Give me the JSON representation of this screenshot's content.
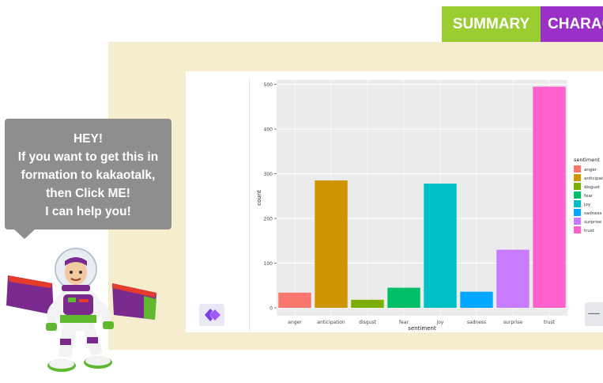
{
  "nav": {
    "summary_label": "SUMMARY",
    "character_label": "CHARAC"
  },
  "speech_bubble": {
    "lines": [
      "HEY!",
      "If you want to get this in",
      "formation to kakaotalk,",
      "then Click ME!",
      "I can help you!"
    ]
  },
  "colors": {
    "summary_tab": "#9acd32",
    "character_tab": "#9b30c8",
    "panel_bg": "#f6ecce",
    "bubble_bg": "#8e8e8e",
    "plot_bg": "#ebebeb"
  },
  "icons": {
    "diamond_button": "diamond-logo-icon",
    "minus_button": "minus-icon"
  },
  "minus_label": "—",
  "chart_data": {
    "type": "bar",
    "xlabel": "sentiment",
    "ylabel": "count",
    "ylim": [
      0,
      510
    ],
    "yticks": [
      0,
      100,
      200,
      300,
      400,
      500
    ],
    "categories": [
      "anger",
      "anticipation",
      "disgust",
      "fear",
      "joy",
      "sadness",
      "surprise",
      "trust"
    ],
    "values": [
      34,
      285,
      18,
      45,
      278,
      36,
      130,
      495
    ],
    "colors": [
      "#f8766d",
      "#cd9600",
      "#7cae00",
      "#00be67",
      "#00bfc4",
      "#00a9ff",
      "#c77cff",
      "#ff61cc"
    ],
    "grid": true,
    "legend": {
      "title": "sentiment",
      "position": "right",
      "labels": [
        "anger",
        "anticipat",
        "disgust",
        "fear",
        "joy",
        "sadness",
        "surprise",
        "trust"
      ]
    }
  }
}
